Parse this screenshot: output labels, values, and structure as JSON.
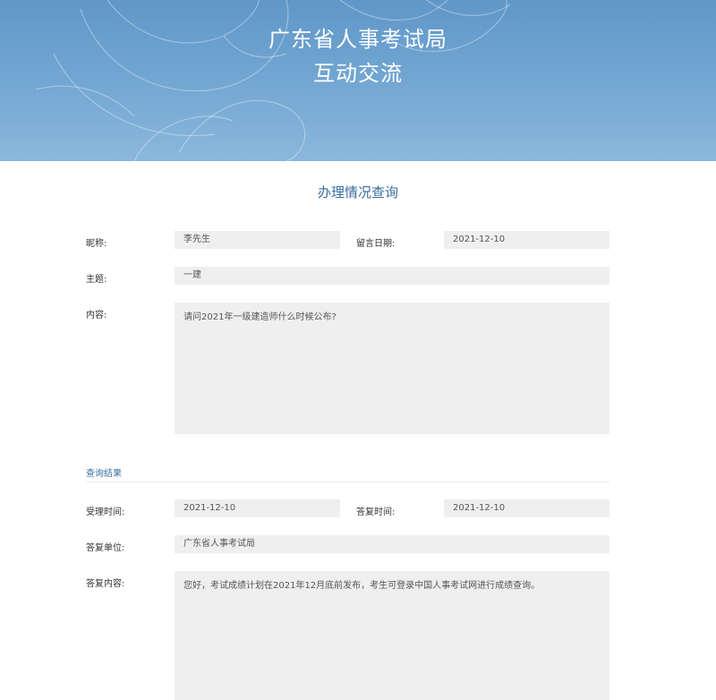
{
  "header": {
    "title_line1": "广东省人事考试局",
    "title_line2": "互动交流",
    "bg_color": "#6a9fcd"
  },
  "section": {
    "title": "办理情况查询"
  },
  "form": {
    "nickname_label": "昵称:",
    "nickname_value": "李先生",
    "date_label": "留言日期:",
    "date_value": "2021-12-10",
    "subject_label": "主题:",
    "subject_value": "一建",
    "content_label": "内容:",
    "content_value": "请问2021年一级建造师什么时候公布?"
  },
  "result": {
    "title": "查询结果",
    "accept_time_label": "受理时间:",
    "accept_time_value": "2021-12-10",
    "reply_time_label": "答复时间:",
    "reply_time_value": "2021-12-10",
    "reply_unit_label": "答复单位:",
    "reply_unit_value": "广东省人事考试局",
    "reply_content_label": "答复内容:",
    "reply_content_value": "您好，考试成绩计划在2021年12月底前发布，考生可登录中国人事考试网进行成绩查询。"
  }
}
